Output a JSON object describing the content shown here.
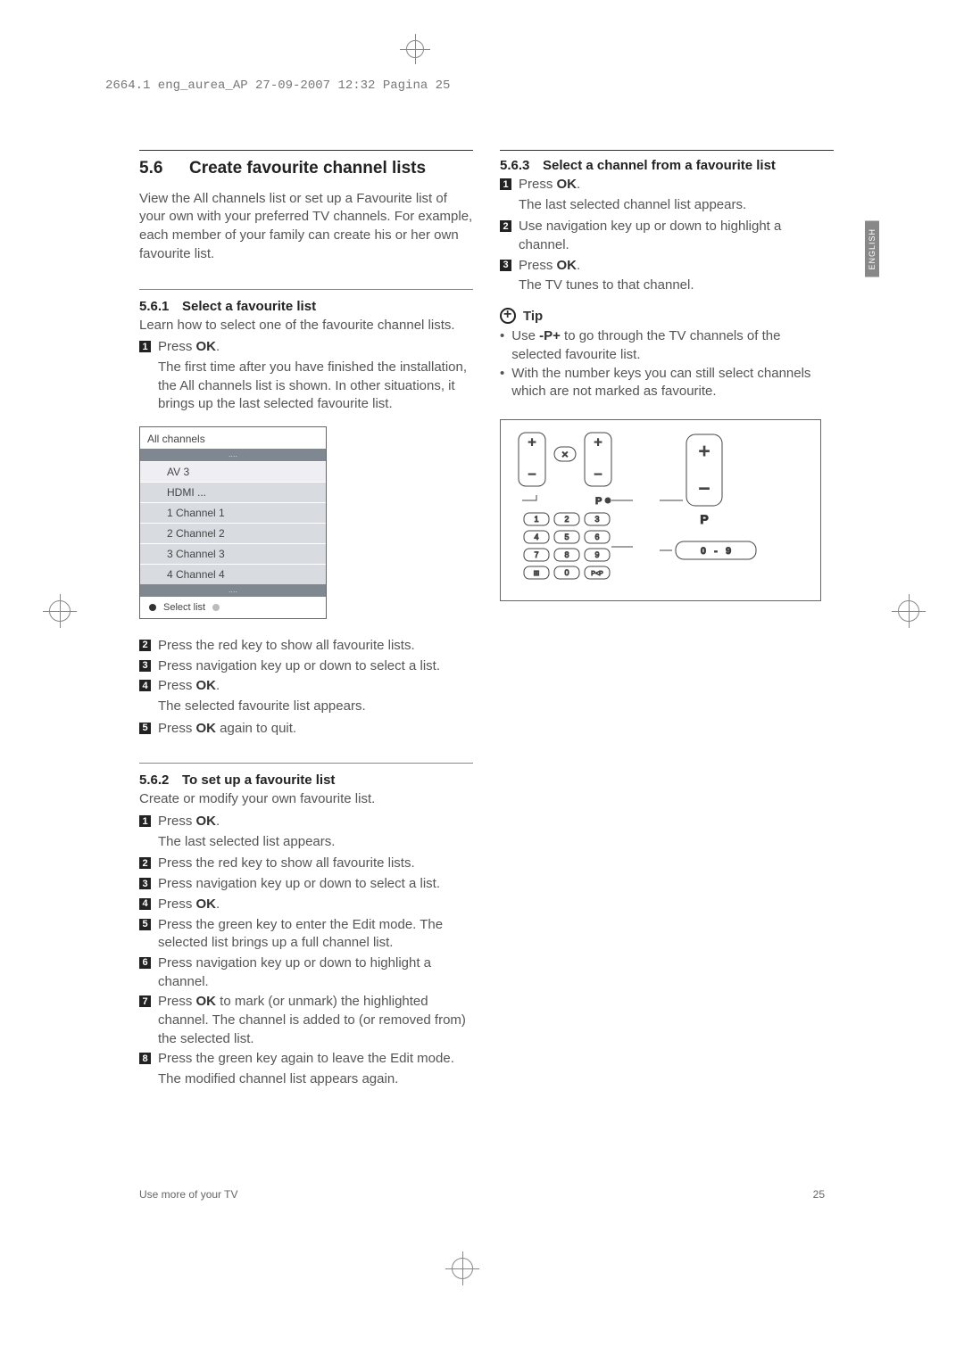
{
  "header": "2664.1 eng_aurea_AP  27-09-2007  12:32  Pagina 25",
  "lang_tab": "ENGLISH",
  "section": {
    "number": "5.6",
    "title": "Create favourite channel lists",
    "intro": "View the All channels list or set up a Favourite list of your own with your preferred TV channels. For example, each member of your family can create his or her own favourite list."
  },
  "s561": {
    "num": "5.6.1",
    "title": "Select a favourite list",
    "intro": "Learn how to select one of the favourite channel lists.",
    "step1": "Press ",
    "ok": "OK",
    "step1b": ".",
    "step1_sub": "The first time after you have finished the installation, the All channels list is shown. In other situations, it brings up the last selected favourite list.",
    "step2": "Press the red key to show all favourite lists.",
    "step3": "Press navigation key up or down to select a list.",
    "step4": "Press ",
    "step4_sub": "The selected favourite list appears.",
    "step5a": "Press ",
    "step5b": " again to quit."
  },
  "channel_list": {
    "title": "All channels",
    "dots": "....",
    "items": [
      "AV 3",
      "HDMI ...",
      "1 Channel 1",
      "2 Channel 2",
      "3 Channel 3",
      "4 Channel 4"
    ],
    "footer": "Select list"
  },
  "s562": {
    "num": "5.6.2",
    "title": "To set up a favourite list",
    "intro": "Create or modify your own favourite list.",
    "step1": "Press ",
    "step1_sub": "The last selected list appears.",
    "step2": "Press the red key to show all favourite lists.",
    "step3": "Press navigation key up or down to select a list.",
    "step4": "Press ",
    "step5": "Press the green key to enter the Edit mode. The selected list brings up a full channel list.",
    "step6": "Press navigation key up or down to highlight a channel.",
    "step7a": "Press ",
    "step7b": " to mark (or unmark) the highlighted channel. The channel is added to (or removed from) the selected list.",
    "step8": "Press the green key again to leave the Edit mode.",
    "step8_sub": "The modified channel list appears again."
  },
  "s563": {
    "num": "5.6.3",
    "title": "Select a channel from a favourite list",
    "step1": "Press ",
    "step1_sub": "The last selected channel list appears.",
    "step2": "Use navigation key up or down to highlight a channel.",
    "step3": "Press ",
    "step3_sub": "The TV tunes to that channel."
  },
  "tip": {
    "label": "Tip",
    "b1a": "Use ",
    "b1_key": "-P+",
    "b1b": " to go through the TV channels of the selected favourite list.",
    "b2": "With the number keys you can still select channels which are not marked as favourite."
  },
  "remote": {
    "p_label": "P",
    "digits": [
      "1",
      "2",
      "3",
      "4",
      "5",
      "6",
      "7",
      "8",
      "9",
      "0"
    ],
    "display": "0   -   9"
  },
  "footer": {
    "left": "Use more of your TV",
    "right": "25"
  }
}
